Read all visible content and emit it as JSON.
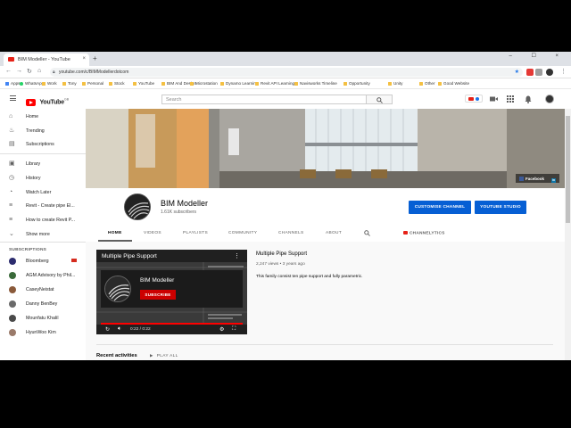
{
  "browser": {
    "tab_title": "BIM Modeller - YouTube",
    "tab_close": "×",
    "new_tab": "+",
    "window_controls": "– ☐ ×",
    "url": "youtube.com/c/BIMModellerdotcom",
    "bookmarks": [
      {
        "label": "Apps",
        "type": "app"
      },
      {
        "label": "WhatsApp",
        "type": "wa"
      },
      {
        "label": "Work",
        "type": "folder"
      },
      {
        "label": "Tony",
        "type": "folder"
      },
      {
        "label": "Personal",
        "type": "folder"
      },
      {
        "label": "Stock",
        "type": "folder"
      },
      {
        "label": "YouTube",
        "type": "folder"
      },
      {
        "label": "BIM And Design",
        "type": "folder"
      },
      {
        "label": "Microstation",
        "type": "folder"
      },
      {
        "label": "Dynamo Learning",
        "type": "folder"
      },
      {
        "label": "Revit API Learning",
        "type": "folder"
      },
      {
        "label": "Navisworks Timeline",
        "type": "folder"
      },
      {
        "label": "Opportunity",
        "type": "folder"
      },
      {
        "label": "Unity",
        "type": "folder"
      },
      {
        "label": "Other",
        "type": "folder"
      },
      {
        "label": "Good Website",
        "type": "folder"
      }
    ]
  },
  "youtube": {
    "logo_text": "YouTube",
    "logo_region": "GB",
    "search_placeholder": "Search"
  },
  "sidebar": {
    "items": [
      {
        "label": "Home",
        "icon": "home-icon",
        "glyph": "⌂"
      },
      {
        "label": "Trending",
        "icon": "trending-icon",
        "glyph": "♨"
      },
      {
        "label": "Subscriptions",
        "icon": "subscriptions-icon",
        "glyph": "▤"
      },
      {
        "label": "Library",
        "icon": "library-icon",
        "glyph": "▣"
      },
      {
        "label": "History",
        "icon": "history-icon",
        "glyph": "◷"
      },
      {
        "label": "Watch Later",
        "icon": "clock-icon",
        "glyph": "◔"
      },
      {
        "label": "Revit - Create pipe El...",
        "icon": "playlist-icon",
        "glyph": "≡"
      },
      {
        "label": "How to create Revit P...",
        "icon": "playlist-icon",
        "glyph": "≡"
      },
      {
        "label": "Show more",
        "icon": "chevron-down-icon",
        "glyph": "⌄"
      }
    ],
    "subscriptions_heading": "SUBSCRIPTIONS",
    "subscriptions": [
      {
        "label": "Bloomberg",
        "color": "#2c2c6e"
      },
      {
        "label": "AGM Advisory by Phil...",
        "color": "#3a6a3a"
      },
      {
        "label": "CaseyNeistat",
        "color": "#8a5a3a"
      },
      {
        "label": "Danny BenBey",
        "color": "#6a6a6a"
      },
      {
        "label": "Mounfatu Khalil",
        "color": "#4a4a4a"
      },
      {
        "label": "HyunWoo Kim",
        "color": "#9a7a6a"
      }
    ]
  },
  "channel": {
    "facebook_label": "Facebook",
    "name": "BIM Modeller",
    "subscribers": "1.61K subscribers",
    "customise_button": "CUSTOMISE CHANNEL",
    "studio_button": "YOUTUBE STUDIO",
    "tabs": [
      "HOME",
      "VIDEOS",
      "PLAYLISTS",
      "COMMUNITY",
      "CHANNELS",
      "ABOUT"
    ],
    "channelytics_label": "CHANNELYTICS"
  },
  "featured": {
    "title": "Multiple Pipe Support",
    "endcard_name": "BIM Modeller",
    "endcard_subscribe": "SUBSCRIBE",
    "time": "0:22 / 0:22",
    "progress": 1.0,
    "info_title": "Multiple Pipe Support",
    "meta": "2,247 views • 3 years ago",
    "description": "This family consist ten pipe support and fully parametric."
  },
  "sections": {
    "recent_label": "Recent activities",
    "play_all": "PLAY ALL"
  },
  "colors": {
    "accent_blue": "#065fd4",
    "youtube_red": "#ff0000"
  }
}
